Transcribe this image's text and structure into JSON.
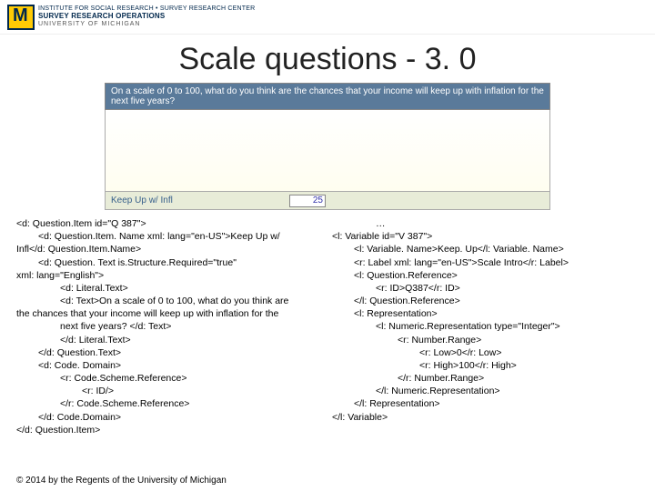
{
  "header": {
    "line1": "INSTITUTE FOR SOCIAL RESEARCH • SURVEY RESEARCH CENTER",
    "line2": "SURVEY RESEARCH OPERATIONS",
    "line3": "UNIVERSITY OF MICHIGAN"
  },
  "title_a": "Scale",
  "title_b": " questions - 3. 0",
  "q_prompt": "On a scale of 0 to 100, what do you think are the chances that your income will keep up with inflation for the next five years?",
  "q_label": "Keep Up w/ Infl",
  "q_value": "25",
  "left": [
    {
      "c": "",
      "t": "<d: Question.Item id=\"Q 387\">"
    },
    {
      "c": "i1",
      "t": "<d: Question.Item. Name xml: lang=\"en-US\">Keep Up w/"
    },
    {
      "c": "",
      "t": "Infl</d: Question.Item.Name>"
    },
    {
      "c": "i1",
      "t": "<d: Question. Text is.Structure.Required=\"true\""
    },
    {
      "c": "",
      "t": "xml: lang=\"English\">"
    },
    {
      "c": "i2",
      "t": "<d: Literal.Text>"
    },
    {
      "c": "i2",
      "t": "<d: Text>On a scale of 0 to 100, what do you think are"
    },
    {
      "c": "",
      "t": "the chances that your income will keep up with inflation for the"
    },
    {
      "c": "i2",
      "t": "next five years? </d: Text>"
    },
    {
      "c": "i2",
      "t": "</d: Literal.Text>"
    },
    {
      "c": "i1",
      "t": "</d: Question.Text>"
    },
    {
      "c": "i1",
      "t": "<d: Code. Domain>"
    },
    {
      "c": "i2",
      "t": "<r: Code.Scheme.Reference>"
    },
    {
      "c": "i3",
      "t": "<r: ID/>"
    },
    {
      "c": "i2",
      "t": "</r: Code.Scheme.Reference>"
    },
    {
      "c": "i1",
      "t": "</d: Code.Domain>"
    },
    {
      "c": "",
      "t": "</d: Question.Item>"
    }
  ],
  "right": [
    {
      "c": "dots",
      "t": "…"
    },
    {
      "c": "",
      "t": "<l: Variable id=\"V 387\">"
    },
    {
      "c": "i1",
      "t": "<l: Variable. Name>Keep. Up</l: Variable. Name>"
    },
    {
      "c": "i1",
      "t": "<r: Label xml: lang=\"en-US\">Scale Intro</r: Label>"
    },
    {
      "c": "i1",
      "t": "<l: Question.Reference>"
    },
    {
      "c": "i2",
      "t": "<r: ID>Q387</r: ID>"
    },
    {
      "c": "i1",
      "t": "</l: Question.Reference>"
    },
    {
      "c": "i1",
      "t": "<l: Representation>"
    },
    {
      "c": "i2",
      "t": "<l: Numeric.Representation type=\"Integer\">"
    },
    {
      "c": "i3",
      "t": "<r: Number.Range>"
    },
    {
      "c": "i4",
      "t": "<r: Low>0</r: Low>"
    },
    {
      "c": "i4",
      "t": "<r: High>100</r: High>"
    },
    {
      "c": "i3",
      "t": "</r: Number.Range>"
    },
    {
      "c": "i2",
      "t": "</l: Numeric.Representation>"
    },
    {
      "c": "i1",
      "t": "</l: Representation>"
    },
    {
      "c": "",
      "t": "</l: Variable>"
    }
  ],
  "copyright": "© 2014 by the Regents of the University of Michigan"
}
